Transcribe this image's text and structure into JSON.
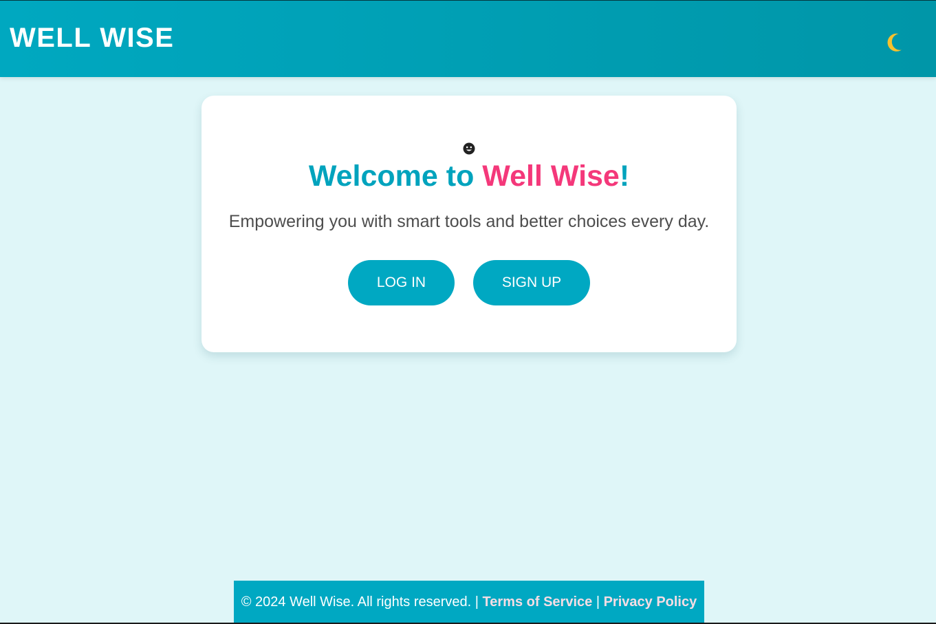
{
  "header": {
    "brand": "WELL WISE",
    "theme_toggle_icon": "crescent-moon-icon",
    "moon_color": "#f5c12e"
  },
  "card": {
    "icon": "smiley-icon",
    "welcome_prefix": "Welcome to ",
    "welcome_brand": "Well Wise",
    "welcome_suffix": "!",
    "tagline": "Empowering you with smart tools and better choices every day.",
    "login_label": "LOG IN",
    "signup_label": "SIGN UP"
  },
  "footer": {
    "copyright": "© 2024 Well Wise. All rights reserved. |",
    "terms_label": "Terms of Service",
    "separator": "|",
    "privacy_label": "Privacy Policy"
  },
  "colors": {
    "primary": "#00a8c2",
    "accent": "#f4387a",
    "background": "#dff6f8",
    "link": "#f7dde4"
  }
}
